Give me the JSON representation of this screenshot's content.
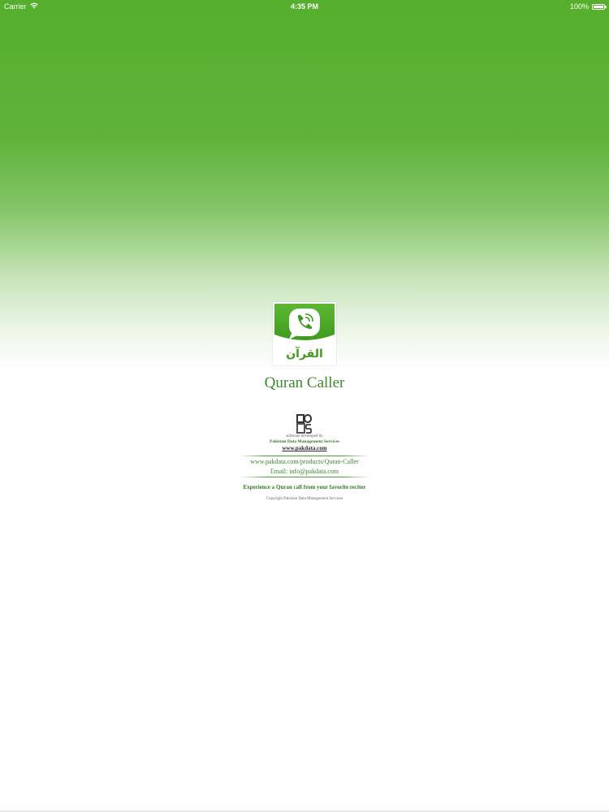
{
  "status_bar": {
    "carrier": "Carrier",
    "time": "4:35 PM",
    "battery": "100%",
    "battery_level": 1.0
  },
  "splash": {
    "app_name": "Quran Caller",
    "icon_arabic": "القرآن",
    "developer": {
      "caption": "software developed by",
      "company": "Pakistan Data Management Services",
      "website": "www.pakdata.com"
    },
    "product_url": "www.pakdata.com/products/Quran-Caller",
    "email_label": "Email:",
    "email": "info@pakdata.com",
    "tagline": "Experience a Quran call from your favorite reciter",
    "copyright": "Copyright Pakistan Data Management Services"
  },
  "colors": {
    "brand_green": "#55af2c",
    "text_green": "#3a8a2b",
    "icon_bubble": "#ffffff"
  },
  "icons": {
    "wifi": "wifi-icon",
    "battery": "battery-icon",
    "app": "phone-chat-bubble-icon",
    "developer_logo": "pdms-logo-icon"
  }
}
